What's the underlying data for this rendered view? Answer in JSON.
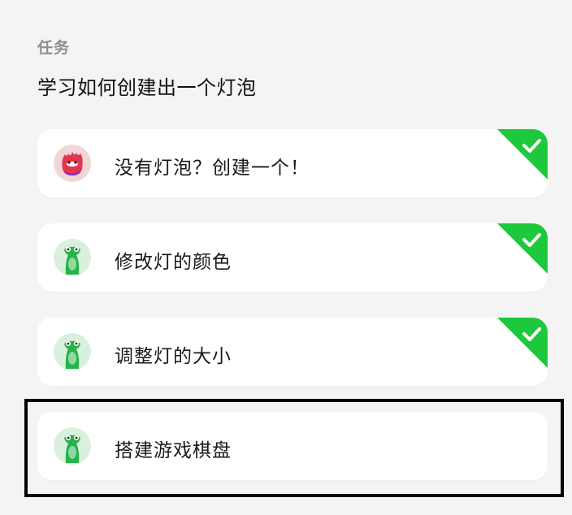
{
  "section_label": "任务",
  "title": "学习如何创建出一个灯泡",
  "tasks": [
    {
      "label": "没有灯泡？创建一个！",
      "avatar": "red-creature-icon",
      "completed": true
    },
    {
      "label": "修改灯的颜色",
      "avatar": "green-lizard-icon",
      "completed": true
    },
    {
      "label": "调整灯的大小",
      "avatar": "green-lizard-icon",
      "completed": true
    },
    {
      "label": "搭建游戏棋盘",
      "avatar": "green-lizard-icon",
      "completed": false
    }
  ],
  "colors": {
    "completed_badge": "#1ec83c",
    "background": "#f4f4f4",
    "card": "#ffffff",
    "selection_border": "#000000"
  }
}
